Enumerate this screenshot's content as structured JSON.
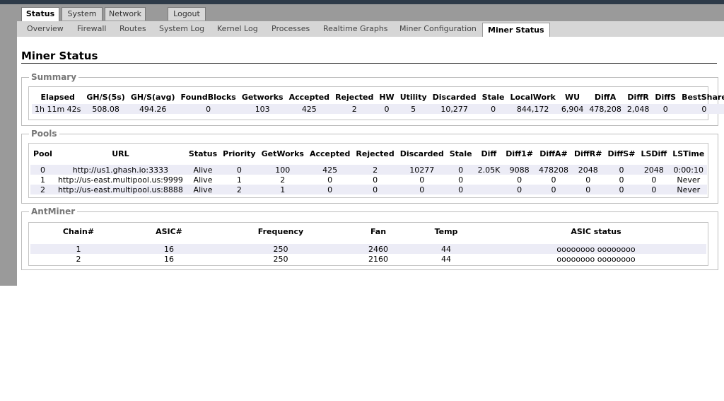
{
  "top_tabs": [
    {
      "label": "Status",
      "active": true
    },
    {
      "label": "System",
      "active": false
    },
    {
      "label": "Network",
      "active": false
    },
    {
      "label": "Logout",
      "active": false
    }
  ],
  "sub_tabs": [
    {
      "label": "Overview"
    },
    {
      "label": "Firewall"
    },
    {
      "label": "Routes"
    },
    {
      "label": "System Log"
    },
    {
      "label": "Kernel Log"
    },
    {
      "label": "Processes"
    },
    {
      "label": "Realtime Graphs"
    },
    {
      "label": "Miner Configuration"
    },
    {
      "label": "Miner Status",
      "active": true
    }
  ],
  "page_title": "Miner Status",
  "summary": {
    "legend": "Summary",
    "headers": [
      "Elapsed",
      "GH/S(5s)",
      "GH/S(avg)",
      "FoundBlocks",
      "Getworks",
      "Accepted",
      "Rejected",
      "HW",
      "Utility",
      "Discarded",
      "Stale",
      "LocalWork",
      "WU",
      "DiffA",
      "DiffR",
      "DiffS",
      "BestShare"
    ],
    "row": [
      "1h 11m 42s",
      "508.08",
      "494.26",
      "0",
      "103",
      "425",
      "2",
      "0",
      "5",
      "10,277",
      "0",
      "844,172",
      "6,904",
      "478,208",
      "2,048",
      "0",
      "0"
    ]
  },
  "pools": {
    "legend": "Pools",
    "headers": [
      "Pool",
      "URL",
      "Status",
      "Priority",
      "GetWorks",
      "Accepted",
      "Rejected",
      "Discarded",
      "Stale",
      "Diff",
      "Diff1#",
      "DiffA#",
      "DiffR#",
      "DiffS#",
      "LSDiff",
      "LSTime"
    ],
    "rows": [
      [
        "0",
        "http://us1.ghash.io:3333",
        "Alive",
        "0",
        "100",
        "425",
        "2",
        "10277",
        "0",
        "2.05K",
        "9088",
        "478208",
        "2048",
        "0",
        "2048",
        "0:00:10"
      ],
      [
        "1",
        "http://us-east.multipool.us:9999",
        "Alive",
        "1",
        "2",
        "0",
        "0",
        "0",
        "0",
        "",
        "0",
        "0",
        "0",
        "0",
        "0",
        "Never"
      ],
      [
        "2",
        "http://us-east.multipool.us:8888",
        "Alive",
        "2",
        "1",
        "0",
        "0",
        "0",
        "0",
        "",
        "0",
        "0",
        "0",
        "0",
        "0",
        "Never"
      ]
    ]
  },
  "antminer": {
    "legend": "AntMiner",
    "headers": [
      "Chain#",
      "ASIC#",
      "Frequency",
      "Fan",
      "Temp",
      "ASIC status"
    ],
    "rows": [
      [
        "1",
        "16",
        "250",
        "2460",
        "44",
        "oooooooo oooooooo"
      ],
      [
        "2",
        "16",
        "250",
        "2160",
        "44",
        "oooooooo oooooooo"
      ]
    ]
  }
}
